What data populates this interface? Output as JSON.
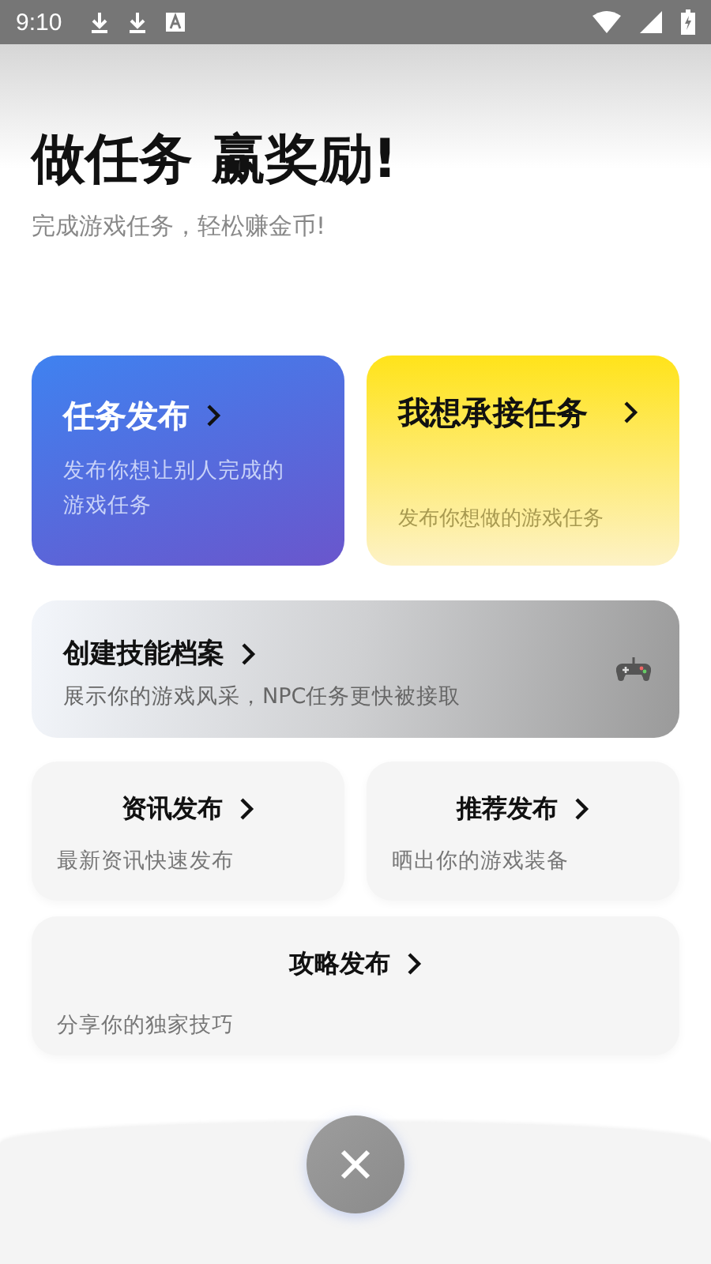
{
  "status_bar": {
    "time": "9:10"
  },
  "header": {
    "title": "做任务 赢奖励!",
    "subtitle": "完成游戏任务，轻松赚金币!"
  },
  "cards": [
    {
      "kind": "blue",
      "title": "任务发布",
      "description": "发布你想让别人完成的游戏任务"
    },
    {
      "kind": "yellow",
      "title": "我想承接任务",
      "description": "发布你想做的游戏任务"
    },
    {
      "kind": "banner",
      "title": "创建技能档案",
      "description": "展示你的游戏风采，NPC任务更快被接取"
    },
    {
      "kind": "small",
      "title": "资讯发布",
      "description": "最新资讯快速发布"
    },
    {
      "kind": "small",
      "title": "推荐发布",
      "description": "晒出你的游戏装备"
    },
    {
      "kind": "wide",
      "title": "攻略发布",
      "description": "分享你的独家技巧"
    }
  ]
}
